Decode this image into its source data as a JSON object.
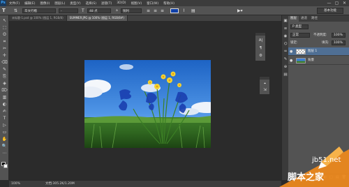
{
  "app": {
    "logo": "Ps",
    "menu": [
      "文件(F)",
      "编辑(E)",
      "图像(I)",
      "图层(L)",
      "类型(Y)",
      "选择(S)",
      "滤镜(T)",
      "3D(D)",
      "视图(V)",
      "窗口(W)",
      "帮助(H)"
    ],
    "window_controls": [
      "—",
      "▢",
      "✕"
    ]
  },
  "options": {
    "tool_glyph": "T",
    "orient_glyph": "⇅",
    "font_family": "华文行楷",
    "font_style": "-",
    "size_glyph": "T",
    "font_size": "48 点",
    "aa_label": "a",
    "aa_mode": "锐利",
    "text_color": "#1040a8",
    "workspace": "基本功能"
  },
  "tabs": [
    {
      "label": "未标题-1.psd @ 100% (图层 1, RGB/8)",
      "active": false
    },
    {
      "label": "SUMMER.JPG @ 100% (图层 1, RGB/8#)",
      "active": true
    }
  ],
  "tools": [
    "↖",
    "⬚",
    "ʘ",
    "⌗",
    "✂",
    "✛",
    "⌫",
    "✎",
    "⎘",
    "◈",
    "⌦",
    "▥",
    "◐",
    "✍",
    "T",
    "▷",
    "▭",
    "✋",
    "🔍",
    "⋯"
  ],
  "panel1": [
    "A|",
    "¶",
    "⚙"
  ],
  "panel2": [
    "⌖",
    "⇲"
  ],
  "dock_icons": [
    "▣",
    "≡",
    "◉",
    "⌬",
    "♒",
    "✎",
    "⊕",
    "▤"
  ],
  "layers": {
    "tabs": [
      "图层",
      "通道",
      "路径"
    ],
    "filter_kind": "P 类型",
    "blend_mode": "正常",
    "opacity_label": "不透明度:",
    "opacity": "100%",
    "lock_label": "锁定:",
    "fill_label": "填充:",
    "fill": "100%",
    "rows": [
      {
        "name": "图层 1",
        "selected": true,
        "eye": "●"
      },
      {
        "name": "背景",
        "selected": false,
        "eye": "●"
      }
    ],
    "footer_icons": [
      "⚭",
      "fx",
      "◐",
      "▢",
      "▤",
      "🗑"
    ]
  },
  "status": {
    "zoom": "100%",
    "doc_info": "文档:305.2K/1.20M"
  },
  "watermark": {
    "url": "jb51.net",
    "name": "脚本之家"
  }
}
